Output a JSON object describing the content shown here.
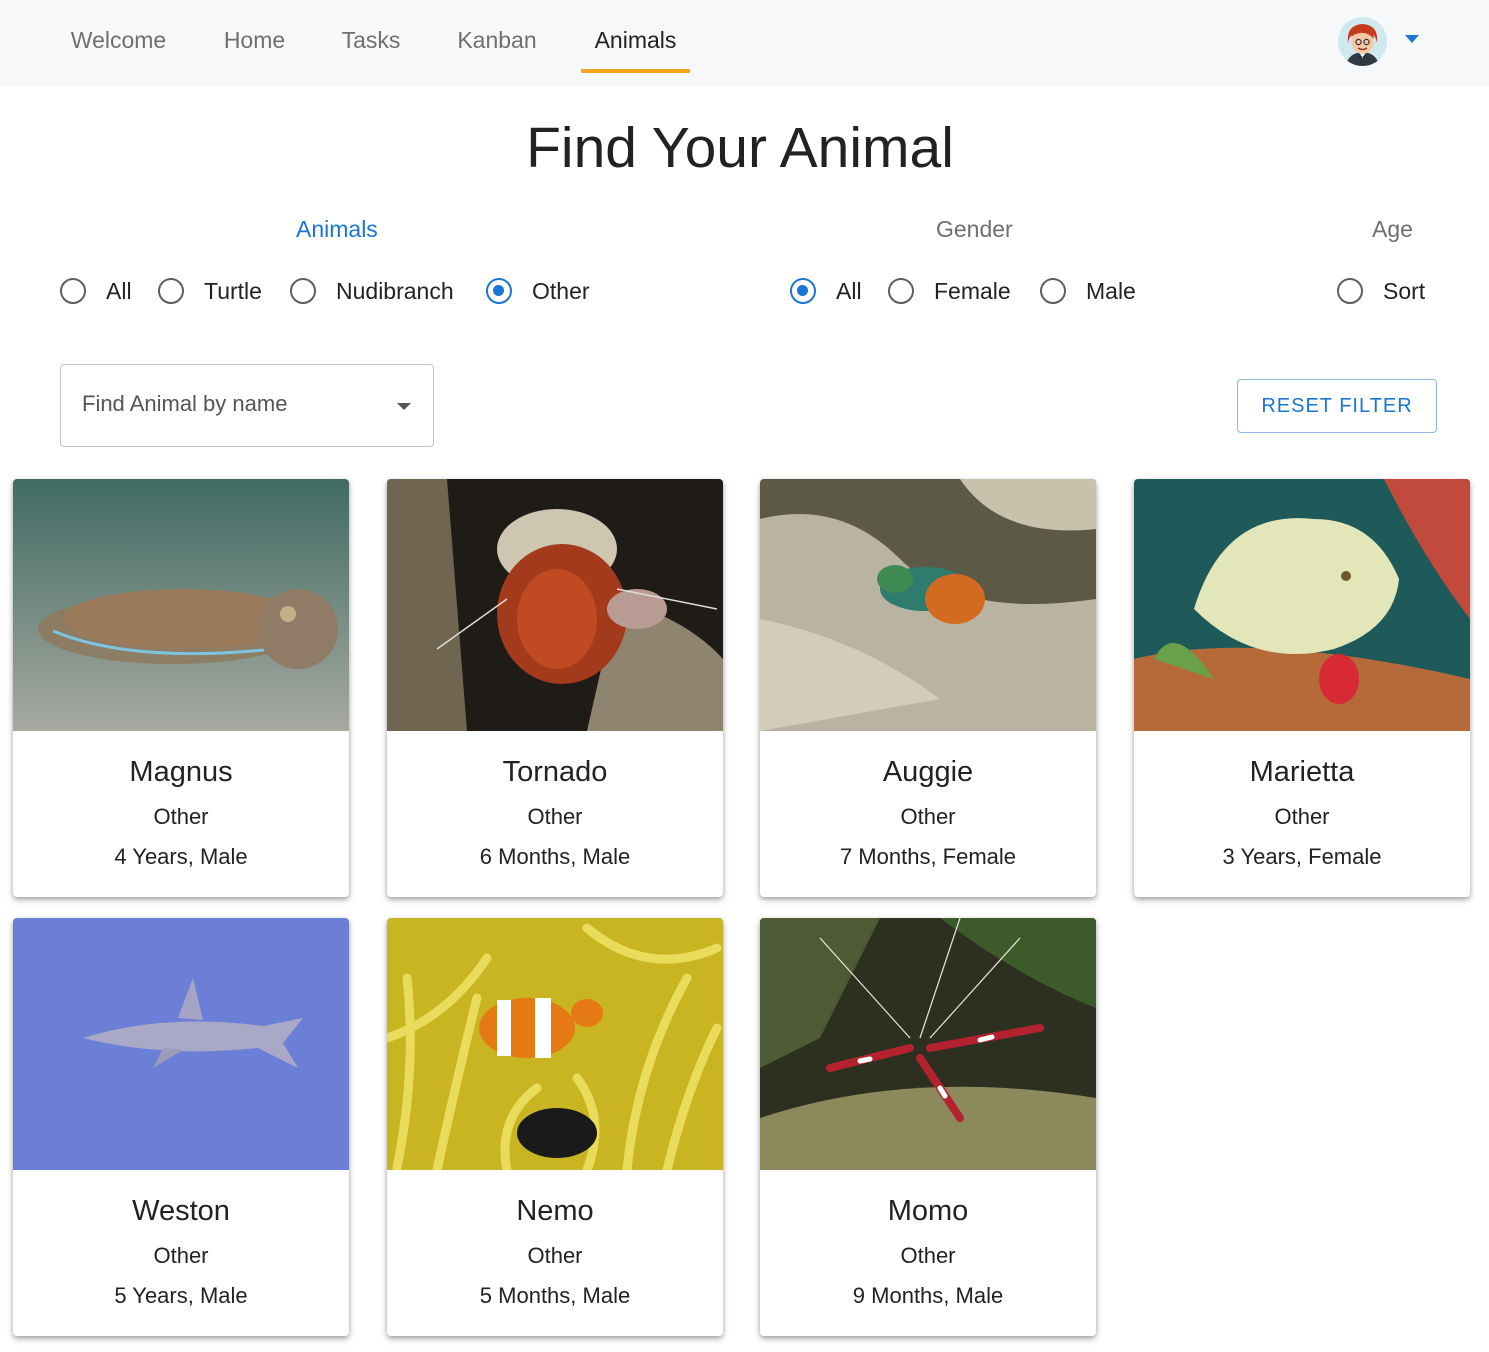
{
  "nav": {
    "tabs": [
      {
        "label": "Welcome"
      },
      {
        "label": "Home"
      },
      {
        "label": "Tasks"
      },
      {
        "label": "Kanban"
      },
      {
        "label": "Animals"
      }
    ],
    "active_tab": "Animals",
    "accent_color": "#f7a31c"
  },
  "user_menu": {
    "avatar_icon": "user-avatar-icon",
    "caret_icon": "caret-down-icon"
  },
  "page": {
    "title": "Find Your Animal"
  },
  "filters": {
    "animals": {
      "label": "Animals",
      "options": [
        "All",
        "Turtle",
        "Nudibranch",
        "Other"
      ],
      "selected": "Other"
    },
    "gender": {
      "label": "Gender",
      "options": [
        "All",
        "Female",
        "Male"
      ],
      "selected": "All"
    },
    "age": {
      "label": "Age",
      "options": [
        "Sort"
      ],
      "selected": ""
    }
  },
  "search": {
    "placeholder": "Find Animal by name"
  },
  "reset_button": {
    "label": "RESET FILTER"
  },
  "primary_color": "#1976d2",
  "animals": [
    {
      "name": "Magnus",
      "type": "Other",
      "info": "4 Years, Male"
    },
    {
      "name": "Tornado",
      "type": "Other",
      "info": "6 Months, Male"
    },
    {
      "name": "Auggie",
      "type": "Other",
      "info": "7 Months, Female"
    },
    {
      "name": "Marietta",
      "type": "Other",
      "info": "3 Years, Female"
    },
    {
      "name": "Weston",
      "type": "Other",
      "info": "5 Years, Male"
    },
    {
      "name": "Nemo",
      "type": "Other",
      "info": "5 Months, Male"
    },
    {
      "name": "Momo",
      "type": "Other",
      "info": "9 Months, Male"
    }
  ]
}
